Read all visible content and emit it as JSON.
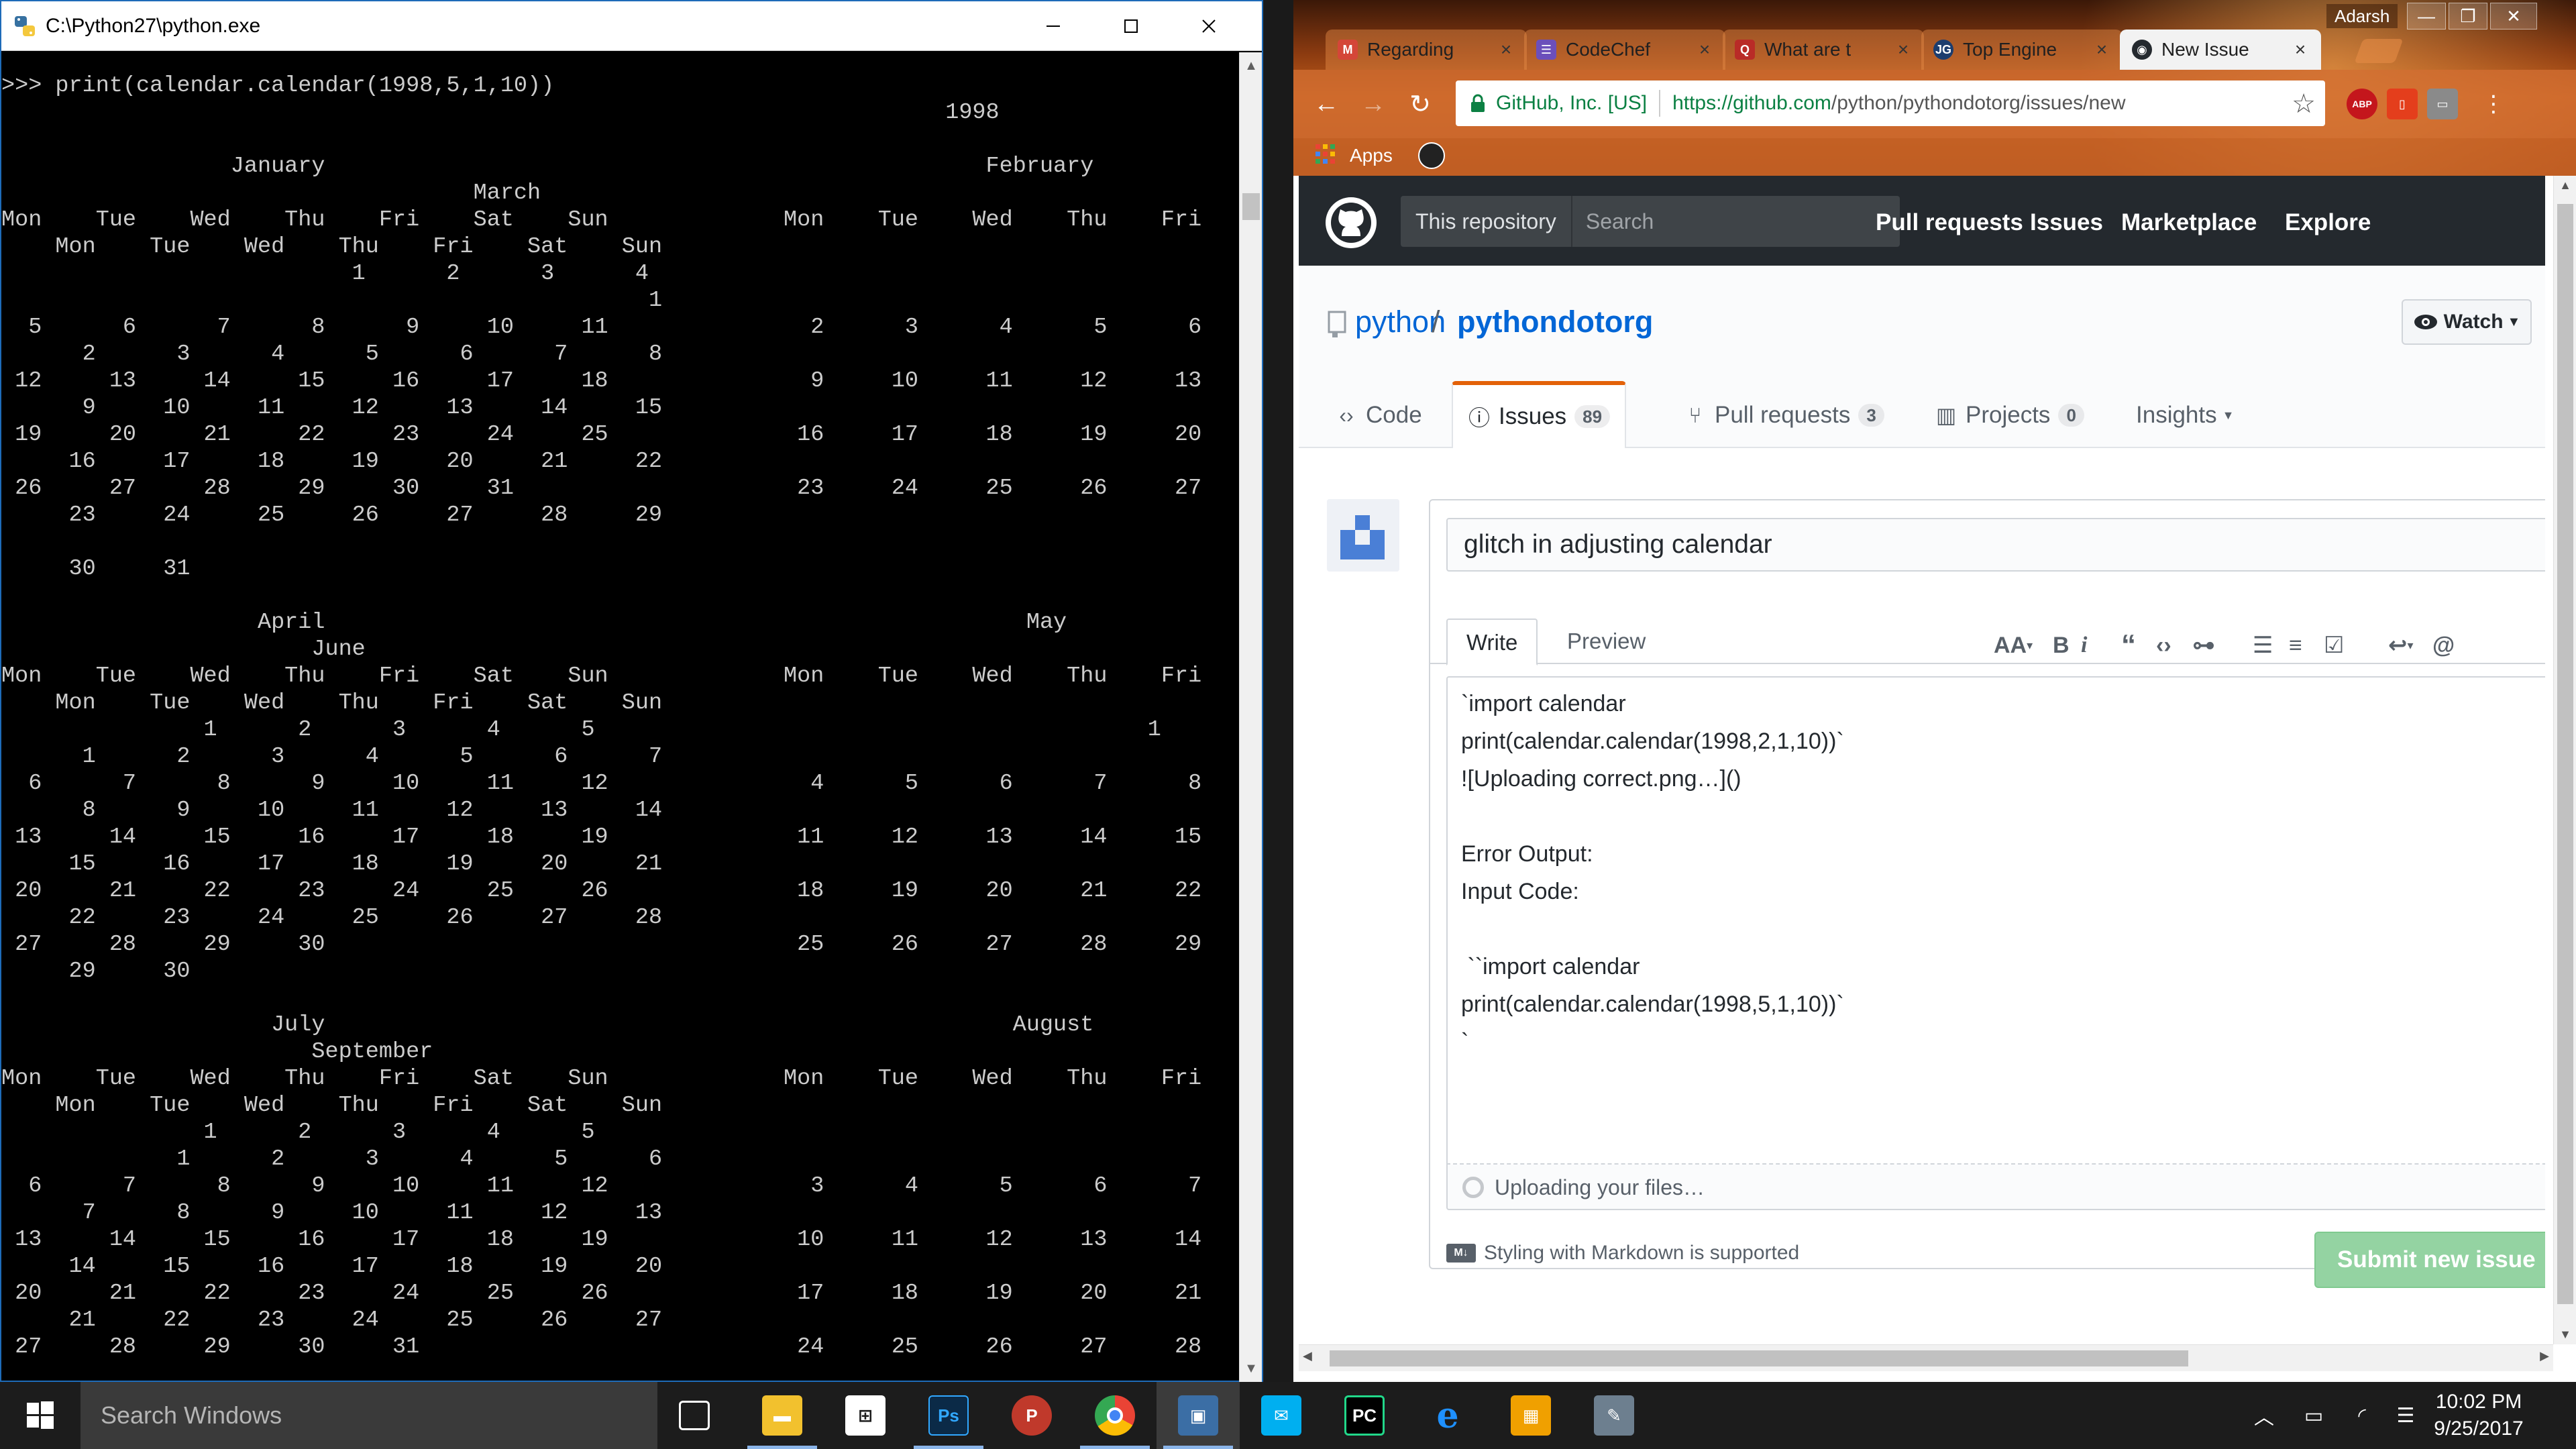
{
  "console": {
    "title": "C:\\Python27\\python.exe",
    "output": ">>> print(calendar.calendar(1998,5,1,10))\n                                                                      1998\n\n                 January                                                 February\n                                   March\nMon    Tue    Wed    Thu    Fri    Sat    Sun             Mon    Tue    Wed    Thu    Fri    Sat    Sun\n    Mon    Tue    Wed    Thu    Fri    Sat    Sun\n                          1      2      3      4                                                    1\n                                                1\n  5      6      7      8      9     10     11               2      3      4      5      6      7      8\n      2      3      4      5      6      7      8\n 12     13     14     15     16     17     18               9     10     11     12     13     14     15\n      9     10     11     12     13     14     15\n 19     20     21     22     23     24     25              16     17     18     19     20     21     22\n     16     17     18     19     20     21     22\n 26     27     28     29     30     31                     23     24     25     26     27     28\n     23     24     25     26     27     28     29\n\n     30     31\n\n                   April                                                    May\n                       June\nMon    Tue    Wed    Thu    Fri    Sat    Sun             Mon    Tue    Wed    Thu    Fri    Sat    Sun\n    Mon    Tue    Wed    Thu    Fri    Sat    Sun\n               1      2      3      4      5                                         1      2      3\n      1      2      3      4      5      6      7\n  6      7      8      9     10     11     12               4      5      6      7      8      9     10\n      8      9     10     11     12     13     14\n 13     14     15     16     17     18     19              11     12     13     14     15     16     17\n     15     16     17     18     19     20     21\n 20     21     22     23     24     25     26              18     19     20     21     22     23     24\n     22     23     24     25     26     27     28\n 27     28     29     30                                   25     26     27     28     29     30     31\n     29     30\n\n                    July                                                   August\n                       September\nMon    Tue    Wed    Thu    Fri    Sat    Sun             Mon    Tue    Wed    Thu    Fri    Sat    Sun\n    Mon    Tue    Wed    Thu    Fri    Sat    Sun\n               1      2      3      4      5                                                1      2\n             1      2      3      4      5      6\n  6      7      8      9     10     11     12               3      4      5      6      7      8      9\n      7      8      9     10     11     12     13\n 13     14     15     16     17     18     19              10     11     12     13     14     15     16\n     14     15     16     17     18     19     20\n 20     21     22     23     24     25     26              17     18     19     20     21     22     23\n     21     22     23     24     25     26     27\n 27     28     29     30     31                            24     25     26     27     28     29     30"
  },
  "chrome": {
    "user": "Adarsh",
    "tabs": [
      {
        "label": "Regarding",
        "favicon": "gmail-icon",
        "color": "#d44638"
      },
      {
        "label": "CodeChef",
        "favicon": "codechef-icon",
        "color": "#5b4638"
      },
      {
        "label": "What are t",
        "favicon": "quora-icon",
        "color": "#b92b27"
      },
      {
        "label": "Top Engine",
        "favicon": "jgi-icon",
        "color": "#1c3d6e"
      },
      {
        "label": "New Issue",
        "favicon": "github-icon",
        "color": "#24292e"
      }
    ],
    "omnibox": {
      "secure_label": "GitHub, Inc. [US]",
      "url_host": "https://github.com",
      "url_path": "/python/pythondotorg/issues/new"
    },
    "extensions": [
      "ABP",
      "office-icon",
      "cast-icon"
    ],
    "bookmarks": {
      "apps_label": "Apps"
    }
  },
  "github": {
    "scope_label": "This repository",
    "search_placeholder": "Search",
    "nav": [
      "Pull requests",
      "Issues",
      "Marketplace",
      "Explore"
    ],
    "repo_owner": "python",
    "repo_name": "pythondotorg",
    "watch_label": "Watch",
    "repo_tabs": {
      "code": "Code",
      "issues": "Issues",
      "issues_count": "89",
      "pulls": "Pull requests",
      "pulls_count": "3",
      "projects": "Projects",
      "projects_count": "0",
      "insights": "Insights"
    },
    "issue_title": "glitch in adjusting calendar",
    "write_tab": "Write",
    "preview_tab": "Preview",
    "body_lines": [
      "`import calendar",
      "print(calendar.calendar(1998,2,1,10))`",
      "![Uploading correct.png…]()",
      "",
      "Error Output:",
      "Input Code:",
      "",
      " ``import calendar",
      "print(calendar.calendar(1998,5,1,10))`",
      "`"
    ],
    "upload_text": "Uploading your files…",
    "markdown_note": "Styling with Markdown is supported",
    "md_badge": "M↓",
    "submit_label": "Submit new issue"
  },
  "taskbar": {
    "search_placeholder": "Search Windows",
    "time": "10:02 PM",
    "date": "9/25/2017"
  }
}
